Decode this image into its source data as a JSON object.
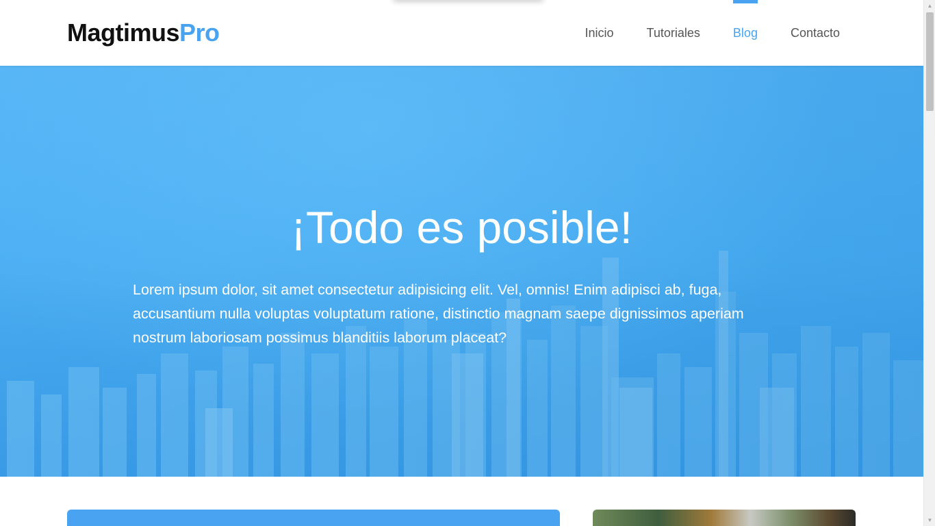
{
  "header": {
    "logo_main": "Magtimus",
    "logo_accent": "Pro",
    "nav": [
      {
        "label": "Inicio",
        "active": false
      },
      {
        "label": "Tutoriales",
        "active": false
      },
      {
        "label": "Blog",
        "active": true
      },
      {
        "label": "Contacto",
        "active": false
      }
    ]
  },
  "hero": {
    "title": "¡Todo es posible!",
    "text": "Lorem ipsum dolor, sit amet consectetur adipisicing elit. Vel, omnis! Enim adipisci ab, fuga, accusantium nulla voluptas voluptatum ratione, distinctio magnam saepe dignissimos aperiam nostrum laboriosam possimus blanditiis laborum placeat?",
    "background": "city-skyline-image"
  },
  "colors": {
    "accent": "#4aa3f0",
    "hero_overlay": "#4db0f4"
  },
  "icons": {
    "scroll_up": "triangle-up",
    "scroll_down": "triangle-down"
  }
}
